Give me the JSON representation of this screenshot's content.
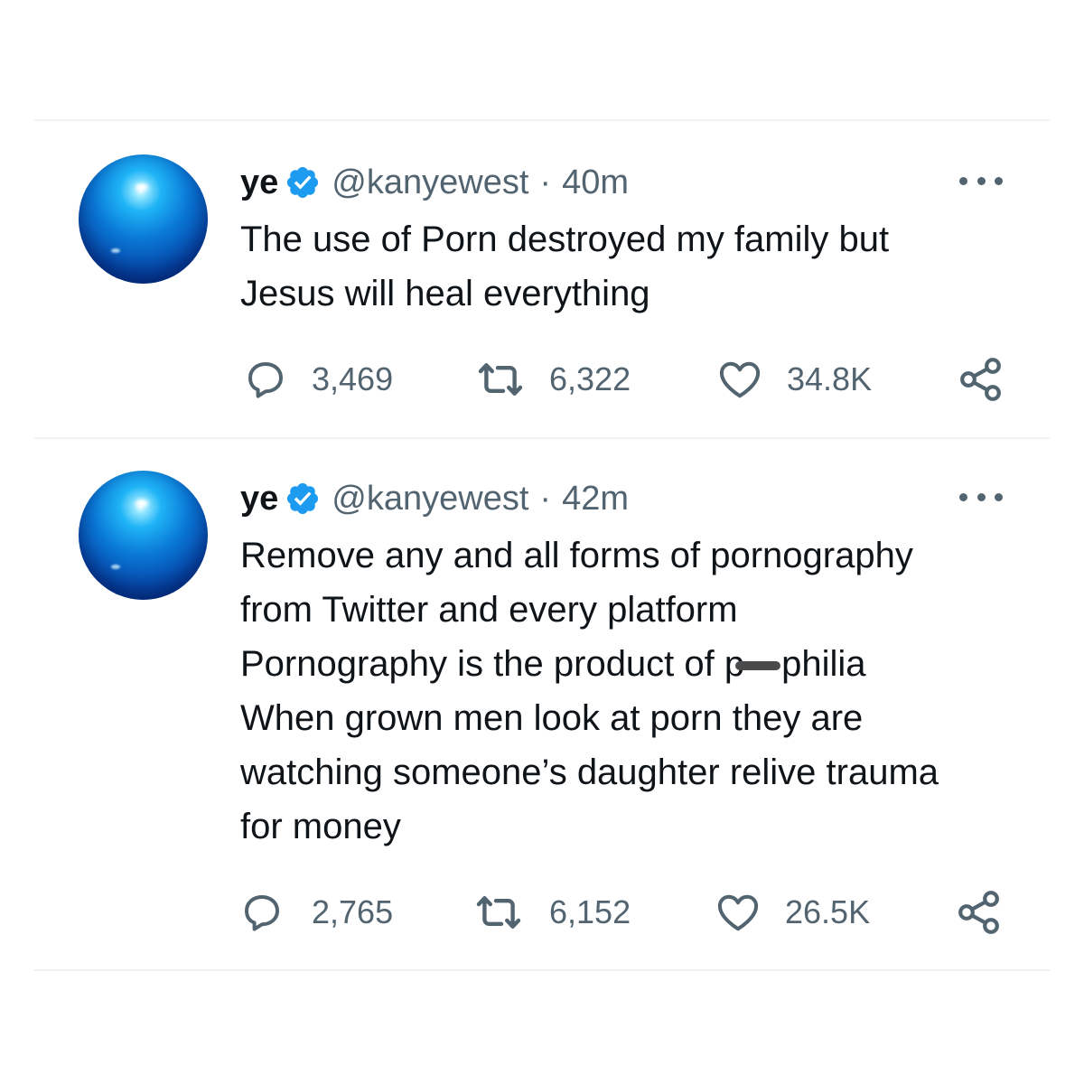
{
  "tweets": [
    {
      "name": "ye",
      "handle": "@kanyewest",
      "separator": "·",
      "time": "40m",
      "text_lines": [
        "The use of Porn destroyed my family but",
        "Jesus will heal everything"
      ],
      "replies": "3,469",
      "retweets": "6,322",
      "likes": "34.8K"
    },
    {
      "name": "ye",
      "handle": "@kanyewest",
      "separator": "·",
      "time": "42m",
      "text_lines": [
        "Remove any and all forms of pornography",
        "from Twitter and every platform",
        "Pornography is the product of p",
        "When grown men look at porn they are",
        "watching someone’s daughter relive trauma",
        "for money"
      ],
      "redacted_suffix": "philia",
      "replies": "2,765",
      "retweets": "6,152",
      "likes": "26.5K"
    }
  ],
  "icons": {
    "verified": "verified-badge-icon",
    "more": "more-options-icon",
    "reply": "reply-icon",
    "retweet": "retweet-icon",
    "like": "heart-icon",
    "share": "share-icon"
  },
  "colors": {
    "verified": "#1d9bf0",
    "secondary_text": "#536471",
    "primary_text": "#0f1419",
    "divider": "#eff3f4"
  }
}
